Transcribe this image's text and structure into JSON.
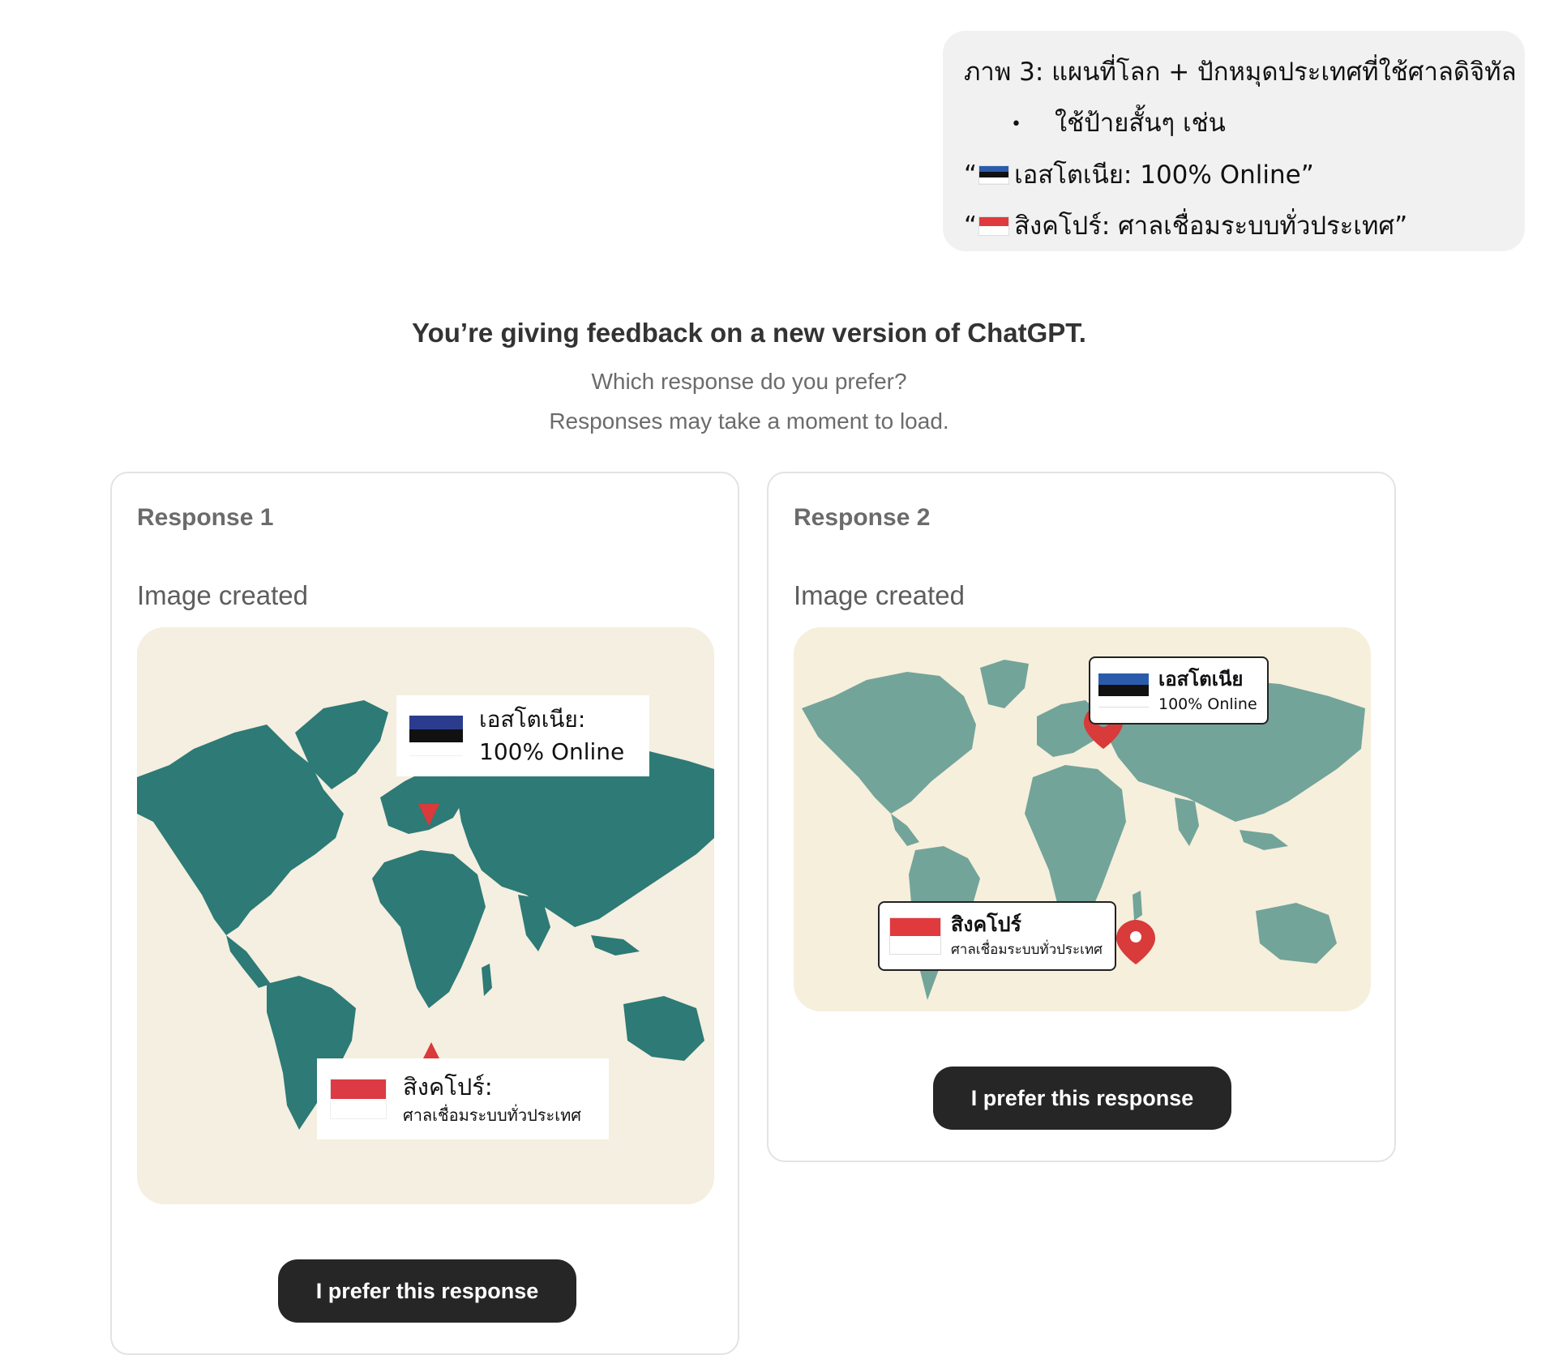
{
  "user_message": {
    "line1": "ภาพ 3: แผนที่โลก + ปักหมุดประเทศที่ใช้ศาลดิจิทัล",
    "bullet": "ใช้ป้ายสั้นๆ เช่น",
    "line3_open": "“",
    "line3_text": "เอสโตเนีย: 100% Online”",
    "line4_open": "“",
    "line4_text": "สิงคโปร์: ศาลเชื่อมระบบทั่วประเทศ”"
  },
  "feedback": {
    "title": "You’re giving feedback on a new version of ChatGPT.",
    "question": "Which response do you prefer?",
    "note": "Responses may take a moment to load."
  },
  "responses": [
    {
      "label": "Response 1",
      "status": "Image created",
      "button": "I prefer this response",
      "map": {
        "estonia_label_line1": "เอสโตเนีย:",
        "estonia_label_line2": "100% Online",
        "singapore_label_line1": "สิงคโปร์:",
        "singapore_label_line2": "ศาลเชื่อมระบบทั่วประเทศ"
      }
    },
    {
      "label": "Response 2",
      "status": "Image created",
      "button": "I prefer this response",
      "map": {
        "estonia_label_line1": "เอสโตเนีย",
        "estonia_label_line2": "100% Online",
        "singapore_label_line1": "สิงคโปร์",
        "singapore_label_line2": "ศาลเชื่อมระบบทั่วประเทศ"
      }
    }
  ],
  "colors": {
    "map_land_1": "#2d7a76",
    "map_land_2": "#72a49a",
    "map_sea": "#f4efe0",
    "pin_red": "#d93a3a",
    "button_bg": "#262626"
  }
}
